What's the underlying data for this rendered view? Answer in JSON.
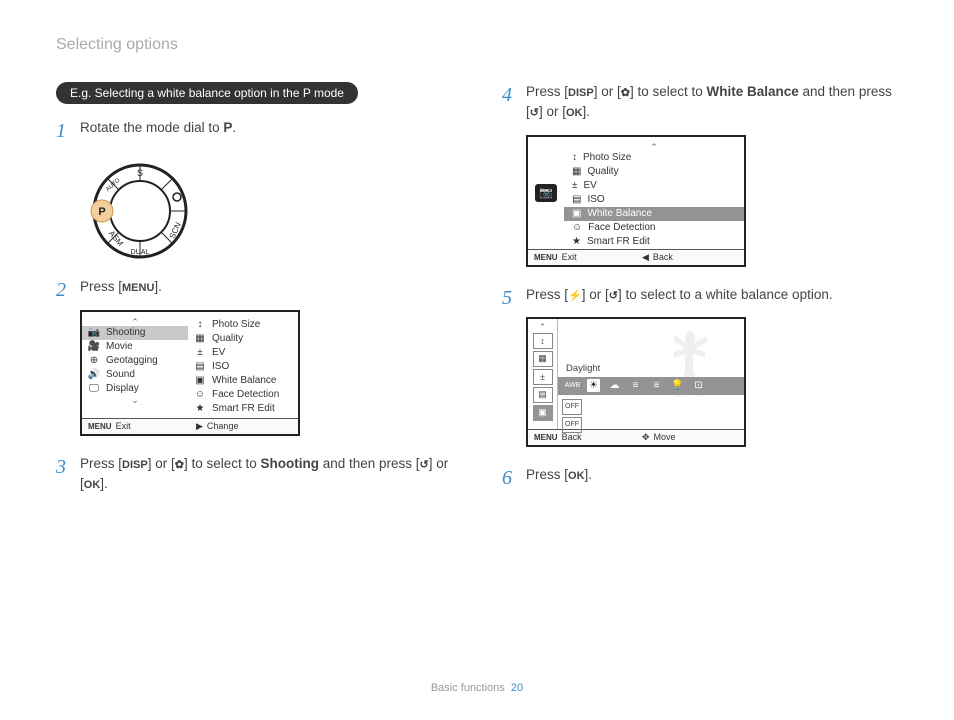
{
  "section_title": "Selecting options",
  "example_pill": "E.g. Selecting a white balance option in the P mode",
  "keys": {
    "menu": "MENU",
    "disp": "DISP",
    "macro": "✿",
    "timer": "↺",
    "ok": "OK",
    "flash": "⚡"
  },
  "steps": {
    "s1_pre": "Rotate the mode dial to ",
    "s1_mode": "P",
    "s1_post": ".",
    "s2_pre": "Press [",
    "s2_post": "].",
    "s3_a": "Press [",
    "s3_b": "] or [",
    "s3_c": "] to select to ",
    "s3_target": "Shooting",
    "s3_d": " and then press [",
    "s3_e": "] or [",
    "s3_f": "].",
    "s4_a": "Press [",
    "s4_b": "] or [",
    "s4_c": "] to select to ",
    "s4_target": "White Balance",
    "s4_d": " and then press [",
    "s4_e": "] or [",
    "s4_f": "].",
    "s5_a": "Press [",
    "s5_b": "] or [",
    "s5_c": "] to select to a white balance option.",
    "s6_a": "Press [",
    "s6_b": "]."
  },
  "step_numbers": {
    "n1": "1",
    "n2": "2",
    "n3": "3",
    "n4": "4",
    "n5": "5",
    "n6": "6"
  },
  "dial": {
    "labels": [
      "P",
      "ASM",
      "DUAL",
      "SCN",
      "S"
    ],
    "AUTO": "AUTO"
  },
  "screenshot1": {
    "left": [
      {
        "icon": "📷",
        "label": "Shooting",
        "selected": true
      },
      {
        "icon": "🎥",
        "label": "Movie"
      },
      {
        "icon": "⊕",
        "label": "Geotagging"
      },
      {
        "icon": "🔊",
        "label": "Sound"
      },
      {
        "icon": "🖵",
        "label": "Display"
      }
    ],
    "right": [
      {
        "icon": "↕",
        "label": "Photo Size"
      },
      {
        "icon": "▦",
        "label": "Quality"
      },
      {
        "icon": "±",
        "label": "EV"
      },
      {
        "icon": "▤",
        "label": "ISO"
      },
      {
        "icon": "▣",
        "label": "White Balance"
      },
      {
        "icon": "☺",
        "label": "Face Detection"
      },
      {
        "icon": "★",
        "label": "Smart FR Edit"
      }
    ],
    "footer": {
      "left_icon": "MENU",
      "left": "Exit",
      "right_icon": "▶",
      "right": "Change"
    }
  },
  "screenshot2": {
    "cam_icon": "📷",
    "items": [
      {
        "icon": "↕",
        "label": "Photo Size"
      },
      {
        "icon": "▦",
        "label": "Quality"
      },
      {
        "icon": "±",
        "label": "EV"
      },
      {
        "icon": "▤",
        "label": "ISO"
      },
      {
        "icon": "▣",
        "label": "White Balance",
        "selected": true
      },
      {
        "icon": "☺",
        "label": "Face Detection"
      },
      {
        "icon": "★",
        "label": "Smart FR Edit"
      }
    ],
    "footer": {
      "left_icon": "MENU",
      "left": "Exit",
      "right_icon": "◀",
      "right": "Back"
    }
  },
  "screenshot3": {
    "left_icons": [
      "↕",
      "▦",
      "±",
      "▤",
      "▣"
    ],
    "bottom_icons": [
      "OFF",
      "OFF"
    ],
    "label": "Daylight",
    "wb_icons": [
      "AWB",
      "☀",
      "☁",
      "≡",
      "≡",
      "💡",
      "⊡"
    ],
    "wb_active_index": 1,
    "footer": {
      "left_icon": "MENU",
      "left": "Back",
      "right_icon": "✥",
      "right": "Move"
    }
  },
  "page_footer": {
    "label": "Basic functions",
    "num": "20"
  }
}
